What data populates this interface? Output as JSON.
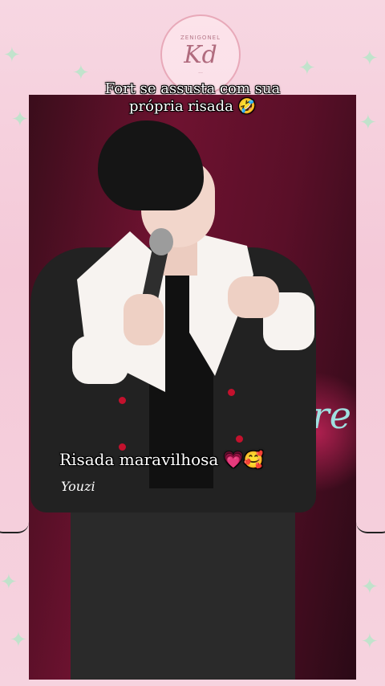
{
  "badge": {
    "top_text": "ZENIGONEL",
    "monogram": "Kd",
    "bottom_text": "..."
  },
  "captions": {
    "top_line1": "Fort  se assusta  com sua",
    "top_line2": "própria  risada 🤣",
    "middle": "Risada  maravilhosa 💗🥰"
  },
  "video": {
    "watermark": "Youzi",
    "stage_text": "re"
  },
  "decor": {
    "sparkle_glyph": "✦",
    "sparkle_color": "#b8e6c9",
    "accent_pink": "#f4c9d8"
  }
}
